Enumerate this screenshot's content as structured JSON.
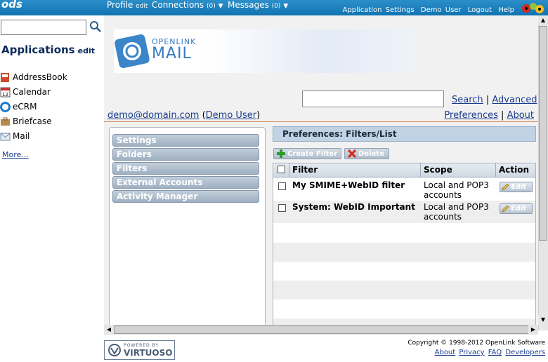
{
  "topbar": {
    "logo": "ods",
    "profile": "Profile",
    "profile_edit": "edit",
    "connections": "Connections",
    "connections_count": "(0)",
    "messages": "Messages",
    "messages_count": "(0)",
    "links": [
      "Application Settings",
      "Demo User",
      "Logout",
      "Help"
    ]
  },
  "left": {
    "search_value": "",
    "apps_title": "Applications",
    "apps_edit": "edit",
    "apps": [
      {
        "label": "AddressBook",
        "icon": "addressbook-icon"
      },
      {
        "label": "Calendar",
        "icon": "calendar-icon"
      },
      {
        "label": "eCRM",
        "icon": "ecrm-icon"
      },
      {
        "label": "Briefcase",
        "icon": "briefcase-icon"
      },
      {
        "label": "Mail",
        "icon": "mail-icon"
      }
    ],
    "more": "More..."
  },
  "banner": {
    "line1": "OPENLINK",
    "line2": "MAIL"
  },
  "search": {
    "value": "",
    "search": "Search",
    "sep": "|",
    "advanced": "Advanced"
  },
  "user": {
    "email": "demo@domain.com",
    "open": "(",
    "name": "Demo User",
    "close": ")"
  },
  "prefs": {
    "preferences": "Preferences",
    "sep": "|",
    "about": "About"
  },
  "nav": [
    "Settings",
    "Folders",
    "Filters",
    "External Accounts",
    "Activity Manager"
  ],
  "panel": {
    "title": "Preferences: Filters/List",
    "create": "Create Filter",
    "delete": "Delete",
    "columns": {
      "filter": "Filter",
      "scope": "Scope",
      "action": "Action"
    },
    "rows": [
      {
        "filter": "My SMIME+WebID filter",
        "scope_l1": "Local and POP3",
        "scope_l2": "accounts",
        "action": "Edit"
      },
      {
        "filter": "System: WebID Important",
        "scope_l1": "Local and POP3",
        "scope_l2": "accounts",
        "action": "Edit"
      }
    ]
  },
  "footer": {
    "powered_by": "POWERED BY",
    "virtuoso": "VIRTUOSO",
    "copyright": "Copyright © 1998-2012 OpenLink Software",
    "links": [
      "About",
      "Privacy",
      "FAQ",
      "Developers"
    ]
  },
  "colors": {
    "topbar": "#1a82c0",
    "link": "#1a3d8f",
    "header_rule": "#d48a58"
  }
}
